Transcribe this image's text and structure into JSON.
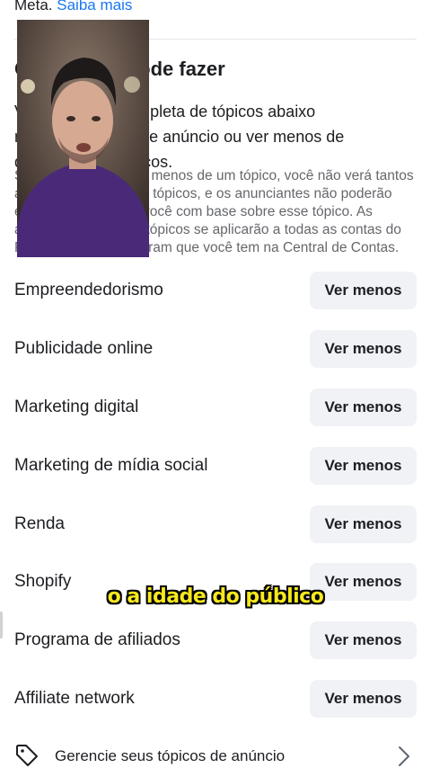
{
  "header": {
    "prefix_text": "Meta.",
    "learn_more_link": "Saiba mais"
  },
  "section": {
    "title": "O que você pode fazer",
    "description": "Veja uma lista completa de tópicos abaixo relacionados a esse anúncio ou ver menos de determinados tópicos.",
    "note": "Se você optar por ver menos de um tópico, você não verá tantos anúncios sobre esses tópicos, e os anunciantes não poderão exibir anúncios para você com base sobre esse tópico. As alterações feitas nos tópicos se aplicarão a todas as contas do Facebook e do Instagram que você tem na Central de Contas."
  },
  "topics": [
    {
      "label": "Empreendedorismo",
      "action": "Ver menos"
    },
    {
      "label": "Publicidade online",
      "action": "Ver menos"
    },
    {
      "label": "Marketing digital",
      "action": "Ver menos"
    },
    {
      "label": "Marketing de mídia social",
      "action": "Ver menos"
    },
    {
      "label": "Renda",
      "action": "Ver menos"
    },
    {
      "label": "Shopify",
      "action": "Ver menos"
    },
    {
      "label": "Programa de afiliados",
      "action": "Ver menos"
    },
    {
      "label": "Affiliate network",
      "action": "Ver menos"
    }
  ],
  "manage": {
    "label": "Gerencie seus tópicos de anúncio",
    "icon": "tag-icon",
    "chevron": "chevron-right-icon"
  },
  "overlay": {
    "caption": "o a idade do público",
    "caption_color": "#f7e81c"
  },
  "colors": {
    "link": "#1877f2",
    "button_bg": "#f0f2f5",
    "secondary_text": "#65676b"
  }
}
